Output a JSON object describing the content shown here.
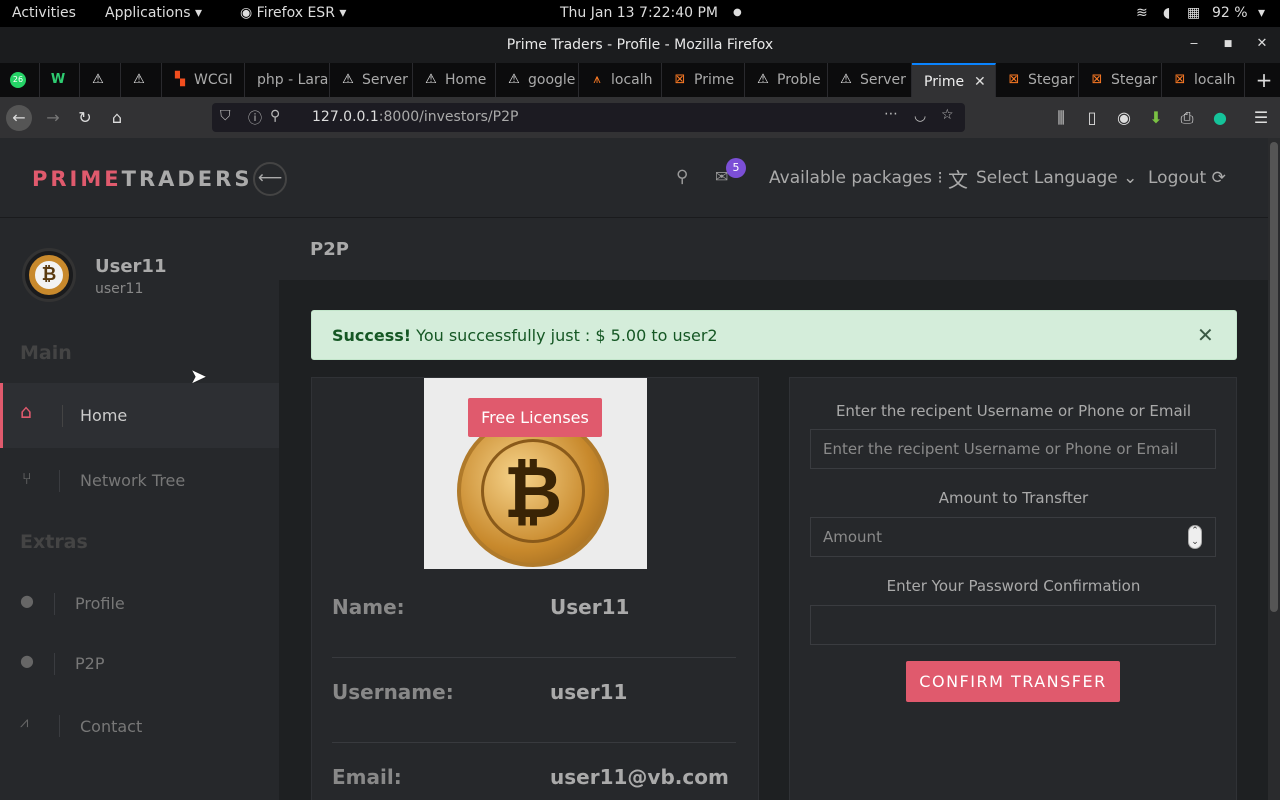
{
  "system": {
    "activities": "Activities",
    "applications": "Applications",
    "browser_menu": "Firefox ESR",
    "datetime": "Thu Jan 13  7:22:40 PM",
    "battery": "92 %"
  },
  "window": {
    "title": "Prime Traders - Profile - Mozilla Firefox"
  },
  "tabs": [
    {
      "label": "",
      "icon": "whatsapp-icon"
    },
    {
      "label": "",
      "icon": "w-icon"
    },
    {
      "label": "",
      "icon": "warning-icon"
    },
    {
      "label": "",
      "icon": "warning-icon"
    },
    {
      "label": "WCGI",
      "icon": "figma-icon"
    },
    {
      "label": "php - Lara",
      "icon": ""
    },
    {
      "label": "Server",
      "icon": "warning-icon"
    },
    {
      "label": "Home",
      "icon": "warning-icon"
    },
    {
      "label": "google",
      "icon": "warning-icon"
    },
    {
      "label": "localh",
      "icon": "xampp-icon"
    },
    {
      "label": "Prime",
      "icon": "xampp-icon"
    },
    {
      "label": "Proble",
      "icon": "warning-icon"
    },
    {
      "label": "Server",
      "icon": "warning-icon"
    },
    {
      "label": "Prime",
      "icon": ""
    },
    {
      "label": "Stegar",
      "icon": "xampp-icon"
    },
    {
      "label": "Stegar",
      "icon": "xampp-icon"
    },
    {
      "label": "localh",
      "icon": "xampp-icon"
    }
  ],
  "urlbar": {
    "host": "127.0.0.1",
    "path": ":8000/investors/P2P"
  },
  "brand": {
    "part1": "PRIME",
    "part2": "TRADERS",
    "accent": "#e05a6d"
  },
  "header": {
    "notifications_count": "5",
    "packages": "Available packages",
    "language": "Select Language",
    "logout": "Logout"
  },
  "user": {
    "display_name": "User11",
    "username": "user11"
  },
  "sidebar": {
    "main_heading": "Main",
    "extras_heading": "Extras",
    "items": [
      {
        "label": "Home"
      },
      {
        "label": "Network Tree"
      },
      {
        "label": "Profile"
      },
      {
        "label": "P2P"
      },
      {
        "label": "Contact"
      }
    ]
  },
  "page": {
    "title": "P2P"
  },
  "alert": {
    "strong": "Success!",
    "text": "You successfully just : $ 5.00 to user2"
  },
  "profile_card": {
    "badge": "Free Licenses",
    "rows": [
      {
        "label": "Name:",
        "value": "User11"
      },
      {
        "label": "Username:",
        "value": "user11"
      },
      {
        "label": "Email:",
        "value": "user11@vb.com"
      }
    ]
  },
  "transfer": {
    "recipient_label": "Enter the recipent Username or Phone or Email",
    "recipient_placeholder": "Enter the recipent Username or Phone or Email",
    "amount_label": "Amount to Transfter",
    "amount_placeholder": "Amount",
    "password_label": "Enter Your Password Confirmation",
    "confirm_button": "CONFIRM TRANSFER"
  },
  "colors": {
    "accent": "#e05a6d",
    "success_bg": "#d4edda",
    "success_text": "#155724",
    "badge_purple": "#7b4fd6"
  }
}
